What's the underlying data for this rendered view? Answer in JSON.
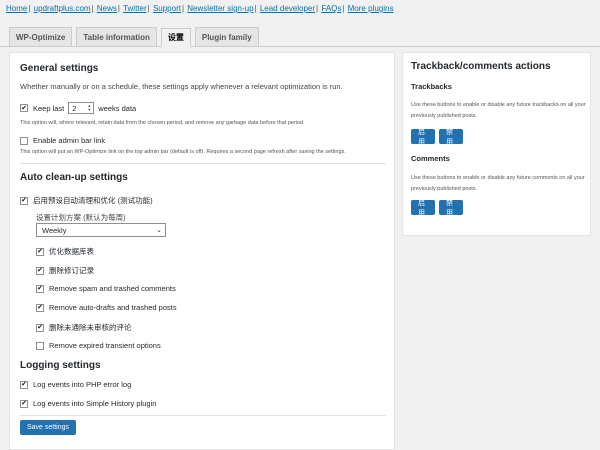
{
  "toplinks": [
    "Home",
    "updraftplus.com",
    "News",
    "Twitter",
    "Support",
    "Newsletter sign-up",
    "Lead developer",
    "FAQs",
    "More plugins"
  ],
  "tabs": [
    "WP-Optimize",
    "Table information",
    "设置",
    "Plugin family"
  ],
  "active_tab": "设置",
  "general": {
    "title": "General settings",
    "desc": "Whether manually or on a schedule, these settings apply whenever a relevant optimization is run.",
    "keep_last_pre": "Keep last",
    "keep_last_value": "2",
    "keep_last_post": "weeks data",
    "keep_last_checked": true,
    "keep_note": "This option will, where relevant, retain data from the chosen period, and remove any garbage data before that period.",
    "admin_bar_label": "Enable admin bar link",
    "admin_bar_checked": false,
    "admin_bar_note": "This option will put an WP-Optimize link on the top admin bar (default is off). Requires a second page refresh after saving the settings."
  },
  "auto": {
    "title": "Auto clean-up settings",
    "enable_label": "启用预设自动清理和优化 (测试功能)",
    "enable_checked": true,
    "schedule_label": "设置计划方案 (默认为每周)",
    "schedule_value": "Weekly",
    "options": [
      {
        "label": "优化数据库表",
        "checked": true
      },
      {
        "label": "删除修订记录",
        "checked": true
      },
      {
        "label": "Remove spam and trashed comments",
        "checked": true
      },
      {
        "label": "Remove auto-drafts and trashed posts",
        "checked": true
      },
      {
        "label": "删除未通除未审核的评论",
        "checked": true
      },
      {
        "label": "Remove expired transient options",
        "checked": false
      }
    ]
  },
  "logging": {
    "title": "Logging settings",
    "options": [
      {
        "label": "Log events into PHP error log",
        "checked": true
      },
      {
        "label": "Log events into Simple History plugin",
        "checked": true
      }
    ]
  },
  "save_label": "Save settings",
  "side": {
    "title": "Trackback/comments actions",
    "trackbacks_title": "Trackbacks",
    "trackbacks_desc_1": "Use these buttons to enable or disable any future trackbacks on all your",
    "trackbacks_desc_2": "previously published posts.",
    "comments_title": "Comments",
    "comments_desc_1": "Use these buttons to enable or disable any future comments on all your",
    "comments_desc_2": "previously published posts.",
    "enable_label": "启用",
    "disable_label": "禁用"
  },
  "icons": {
    "check": "✔",
    "spin_up": "▲",
    "spin_down": "▼",
    "chevron": "⌄"
  }
}
